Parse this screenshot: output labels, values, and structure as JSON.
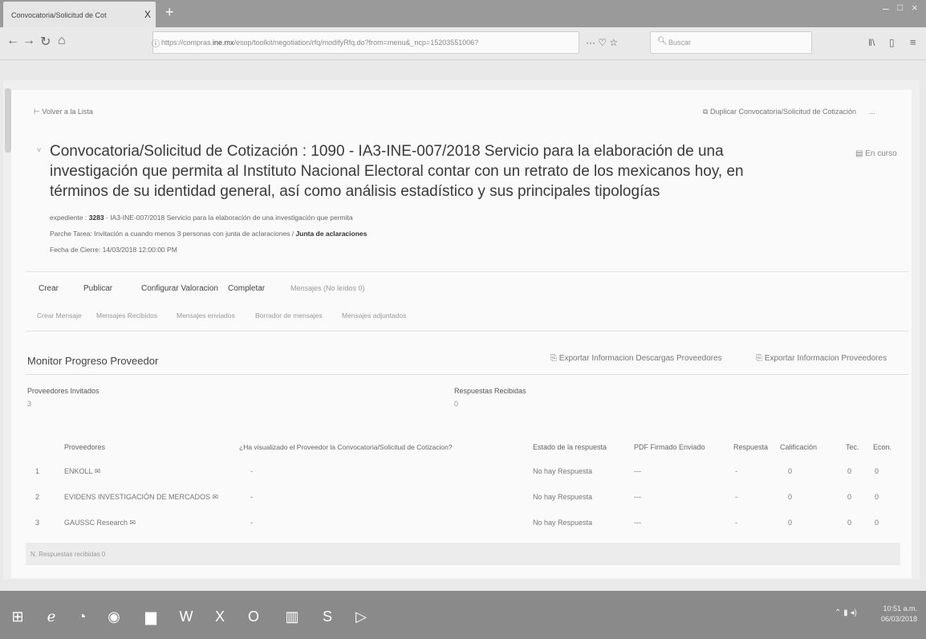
{
  "browser": {
    "tab_title": "Convocatoria/Solicitud de Cot",
    "tab_close": "X",
    "new_tab": "+",
    "url_prefix": "https://compras.",
    "url_host": "ine.mx",
    "url_rest": "/esop/toolkit/negotiation/rfq/modifyRfq.do?from=menu&_ncp=15203551006?",
    "url_more": "··· ♡ ☆",
    "search_placeholder": "Buscar",
    "window_min": "–",
    "window_max": "□",
    "window_close": "×"
  },
  "page": {
    "back_link": "Volver a la Lista",
    "duplicate_link": "Duplicar Convocatoria/Solicitud de Cotización",
    "more_menu": "...",
    "title": "Convocatoria/Solicitud de Cotización : 1090 - IA3-INE-007/2018 Servicio para la elaboración de una investigación que permita al Instituto Nacional Electoral contar con un retrato de los mexicanos hoy, en términos de su identidad general, así como análisis estadístico y sus principales tipologías",
    "status": "En curso",
    "meta": {
      "expediente_label": "expediente :",
      "expediente_value": "3283",
      "expediente_desc": "- IA3-INE-007/2018 Servicio para la elaboración de una investigación que permita",
      "task_label": "Parche Tarea: Invitación a cuando menos 3 personas con junta de aclaraciones /",
      "task_value": "Junta de aclaraciones",
      "close_date": "Fecha de Cierre: 14/03/2018 12:00:00 PM"
    },
    "actions": [
      "Crear",
      "Publicar",
      "Configurar Valoracion",
      "Completar",
      "Mensajes (No leídos 0)"
    ],
    "subnav": [
      "Crear Mensaje",
      "Mensajes Recibidos",
      "Mensajes enviados",
      "Borrador de mensajes",
      "Mensajes adjuntados"
    ]
  },
  "monitor": {
    "title": "Monitor Progreso Proveedor",
    "export_downloads": "Exportar Informacion Descargas Proveedores",
    "export_suppliers": "Exportar Informacion Proveedores",
    "invited_label": "Proveedores Invitados",
    "invited_value": "3",
    "responses_label": "Respuestas Recibidas",
    "responses_value": "0",
    "columns": [
      "Proveedores",
      "¿Ha visualizado el Proveedor la Convocatoria/Solicitud de Cotizacion?",
      "Estado de la respuesta",
      "PDF Firmado Enviado",
      "Respuesta",
      "Calificación",
      "Tec.",
      "Econ."
    ],
    "rows": [
      {
        "n": "1",
        "name": "ENKOLL",
        "viewed": "-",
        "state": "No hay Respuesta",
        "pdf": "---",
        "resp": "-",
        "score": "0",
        "tec": "0",
        "econ": "0"
      },
      {
        "n": "2",
        "name": "EVIDENS INVESTIGACIÓN DE MERCADOS",
        "viewed": "-",
        "state": "No hay Respuesta",
        "pdf": "---",
        "resp": "-",
        "score": "0",
        "tec": "0",
        "econ": "0"
      },
      {
        "n": "3",
        "name": "GAUSSC Research",
        "viewed": "-",
        "state": "No hay Respuesta",
        "pdf": "---",
        "resp": "-",
        "score": "0",
        "tec": "0",
        "econ": "0"
      }
    ],
    "footer": "N. Respuestas recibidas 0"
  },
  "taskbar": {
    "time": "10:51 a.m.",
    "date": "06/03/2018"
  }
}
